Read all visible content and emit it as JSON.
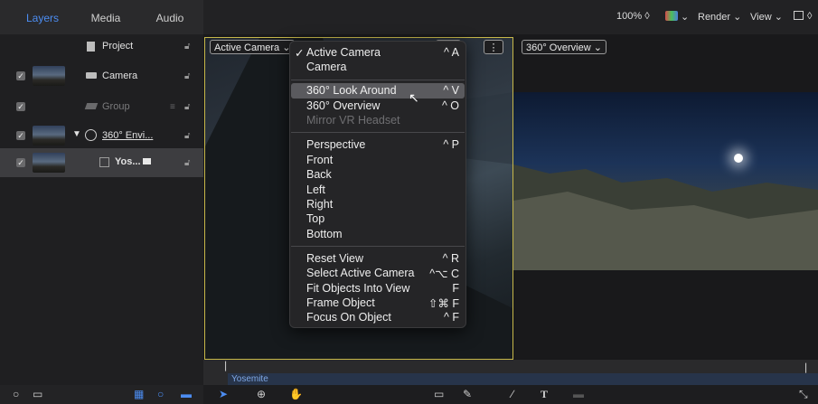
{
  "tabs": [
    {
      "label": "Layers"
    },
    {
      "label": "Media"
    },
    {
      "label": "Audio"
    }
  ],
  "toolbar": {
    "zoom": "100% ◊",
    "render": "Render ⌄",
    "view": "View ⌄"
  },
  "layers": [
    {
      "label": "Project",
      "icon": "project-icon"
    },
    {
      "label": "Camera",
      "icon": "camera-icon"
    },
    {
      "label": "Group",
      "icon": "group-icon"
    },
    {
      "label": "360° Envi...",
      "icon": "360-environment-icon"
    },
    {
      "label": "Yos...",
      "icon": "image-layer-icon"
    }
  ],
  "canvas": {
    "camera_dropdown": "Active Camera ⌄",
    "overview_dropdown": "360° Overview ⌄"
  },
  "menu": {
    "items": [
      {
        "label": "Active Camera",
        "shortcut": "^ A",
        "checked": true
      },
      {
        "label": "Camera",
        "shortcut": ""
      },
      {
        "label": "360° Look Around",
        "shortcut": "^ V",
        "highlighted": true
      },
      {
        "label": "360° Overview",
        "shortcut": "^ O"
      },
      {
        "label": "Mirror VR Headset",
        "shortcut": "",
        "disabled": true
      },
      {
        "label": "Perspective",
        "shortcut": "^ P"
      },
      {
        "label": "Front",
        "shortcut": ""
      },
      {
        "label": "Back",
        "shortcut": ""
      },
      {
        "label": "Left",
        "shortcut": ""
      },
      {
        "label": "Right",
        "shortcut": ""
      },
      {
        "label": "Top",
        "shortcut": ""
      },
      {
        "label": "Bottom",
        "shortcut": ""
      },
      {
        "label": "Reset View",
        "shortcut": "^ R"
      },
      {
        "label": "Select Active Camera",
        "shortcut": "^⌥ C"
      },
      {
        "label": "Fit Objects Into View",
        "shortcut": "F"
      },
      {
        "label": "Frame Object",
        "shortcut": "⇧⌘ F"
      },
      {
        "label": "Focus On Object",
        "shortcut": "^ F"
      }
    ],
    "check_mark": "✓"
  },
  "timeline": {
    "track_label": "Yosemite"
  },
  "colors": {
    "accent": "#4c8df2",
    "viewport_border": "#c7b84a"
  }
}
